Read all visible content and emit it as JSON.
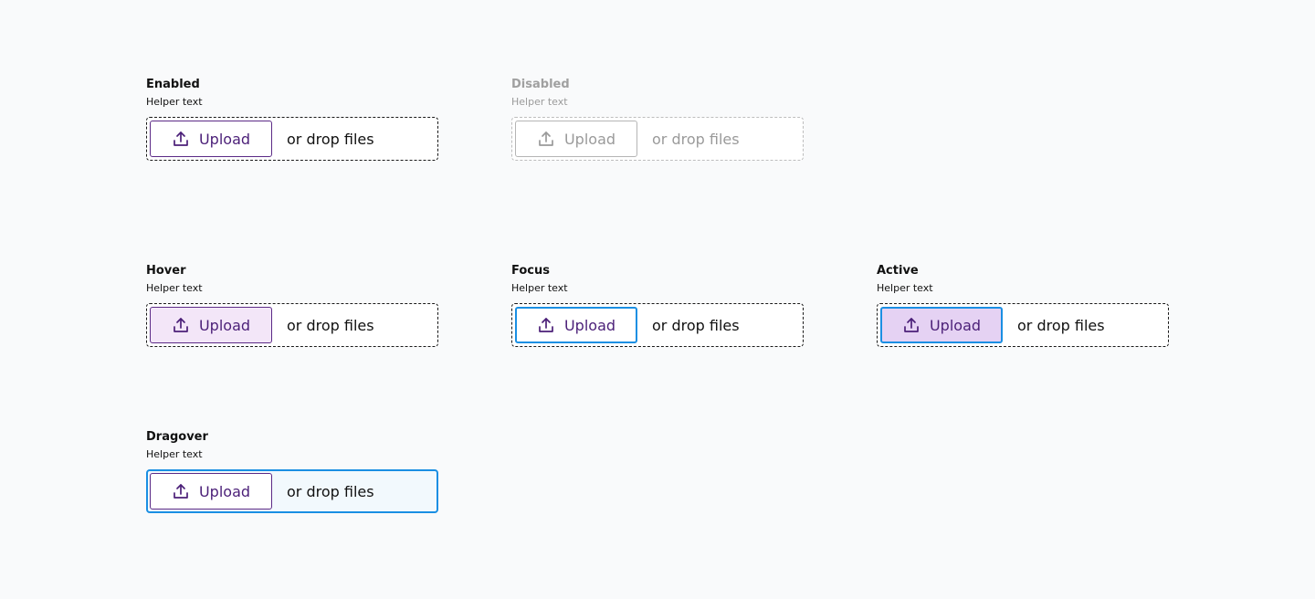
{
  "colors": {
    "accent_purple": "#5b2a86",
    "focus_blue": "#1a8fe3",
    "hover_bg": "#f3e6f8",
    "active_bg": "#e5d2f3",
    "dragover_bg": "#f2f9fd",
    "disabled_gray": "#9a9a9a",
    "page_bg": "#f9fafb"
  },
  "variants": {
    "enabled": {
      "label": "Enabled",
      "helper": "Helper text",
      "button_label": "Upload",
      "drop_text": "or drop files",
      "icon": "upload-icon"
    },
    "disabled": {
      "label": "Disabled",
      "helper": "Helper text",
      "button_label": "Upload",
      "drop_text": "or drop files",
      "icon": "upload-icon"
    },
    "hover": {
      "label": "Hover",
      "helper": "Helper text",
      "button_label": "Upload",
      "drop_text": "or drop files",
      "icon": "upload-icon"
    },
    "focus": {
      "label": "Focus",
      "helper": "Helper text",
      "button_label": "Upload",
      "drop_text": "or drop files",
      "icon": "upload-icon"
    },
    "active": {
      "label": "Active",
      "helper": "Helper text",
      "button_label": "Upload",
      "drop_text": "or drop files",
      "icon": "upload-icon"
    },
    "dragover": {
      "label": "Dragover",
      "helper": "Helper text",
      "button_label": "Upload",
      "drop_text": "or drop files",
      "icon": "upload-icon"
    }
  }
}
